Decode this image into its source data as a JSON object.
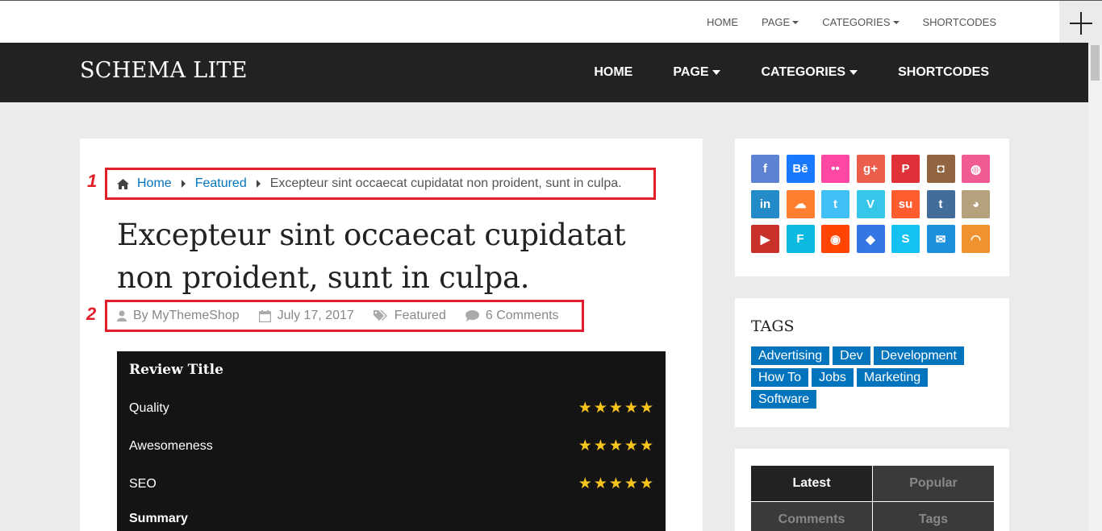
{
  "top_nav": {
    "items": [
      "HOME",
      "PAGE",
      "CATEGORIES",
      "SHORTCODES"
    ]
  },
  "header": {
    "logo": "SCHEMA LITE",
    "nav": [
      "HOME",
      "PAGE",
      "CATEGORIES",
      "SHORTCODES"
    ]
  },
  "annotations": [
    "1",
    "2"
  ],
  "breadcrumb": {
    "home": "Home",
    "category": "Featured",
    "current": "Excepteur sint occaecat cupidatat non proident, sunt in culpa."
  },
  "post": {
    "title": "Excepteur sint occaecat cupidatat non proident, sunt in culpa.",
    "author": "By MyThemeShop",
    "date": "July 17, 2017",
    "category": "Featured",
    "comments": "6 Comments"
  },
  "review": {
    "title": "Review Title",
    "criteria": [
      {
        "label": "Quality",
        "rating": 5
      },
      {
        "label": "Awesomeness",
        "rating": 5
      },
      {
        "label": "SEO",
        "rating": 5
      }
    ],
    "summary_label": "Summary"
  },
  "social_icons": [
    {
      "name": "facebook-icon",
      "glyph": "f",
      "color": "#5d82d1"
    },
    {
      "name": "behance-icon",
      "glyph": "Bē",
      "color": "#1879fd"
    },
    {
      "name": "flickr-icon",
      "glyph": "••",
      "color": "#ff48a3"
    },
    {
      "name": "google-plus-icon",
      "glyph": "g+",
      "color": "#eb5e4c"
    },
    {
      "name": "pinterest-icon",
      "glyph": "P",
      "color": "#e13138"
    },
    {
      "name": "instagram-icon",
      "glyph": "◘",
      "color": "#91653f"
    },
    {
      "name": "dribbble-icon",
      "glyph": "◍",
      "color": "#ef5b92"
    },
    {
      "name": "linkedin-icon",
      "glyph": "in",
      "color": "#238cc8"
    },
    {
      "name": "soundcloud-icon",
      "glyph": "☁",
      "color": "#ff7e30"
    },
    {
      "name": "twitter-icon",
      "glyph": "t",
      "color": "#40bff5"
    },
    {
      "name": "vimeo-icon",
      "glyph": "V",
      "color": "#35c6ea"
    },
    {
      "name": "stumbleupon-icon",
      "glyph": "su",
      "color": "#ff5c30"
    },
    {
      "name": "tumblr-icon",
      "glyph": "t",
      "color": "#426d9b"
    },
    {
      "name": "github-icon",
      "glyph": "◕",
      "color": "#b5a27d"
    },
    {
      "name": "youtube-icon",
      "glyph": "▶",
      "color": "#c9322b"
    },
    {
      "name": "foursquare-icon",
      "glyph": "F",
      "color": "#0cbadf"
    },
    {
      "name": "reddit-icon",
      "glyph": "◉",
      "color": "#ff4500"
    },
    {
      "name": "dropbox-icon",
      "glyph": "◆",
      "color": "#3476e4"
    },
    {
      "name": "skype-icon",
      "glyph": "S",
      "color": "#13c1f3"
    },
    {
      "name": "email-icon",
      "glyph": "✉",
      "color": "#1d90dd"
    },
    {
      "name": "rss-icon",
      "glyph": "◠",
      "color": "#ef922f"
    }
  ],
  "tags_widget": {
    "title": "TAGS",
    "tags": [
      [
        "Advertising",
        "Dev",
        "Development"
      ],
      [
        "How To",
        "Jobs",
        "Marketing"
      ],
      [
        "Software"
      ]
    ]
  },
  "tabs_widget": {
    "tabs": [
      "Latest",
      "Popular",
      "Comments",
      "Tags"
    ],
    "active": "Latest"
  }
}
